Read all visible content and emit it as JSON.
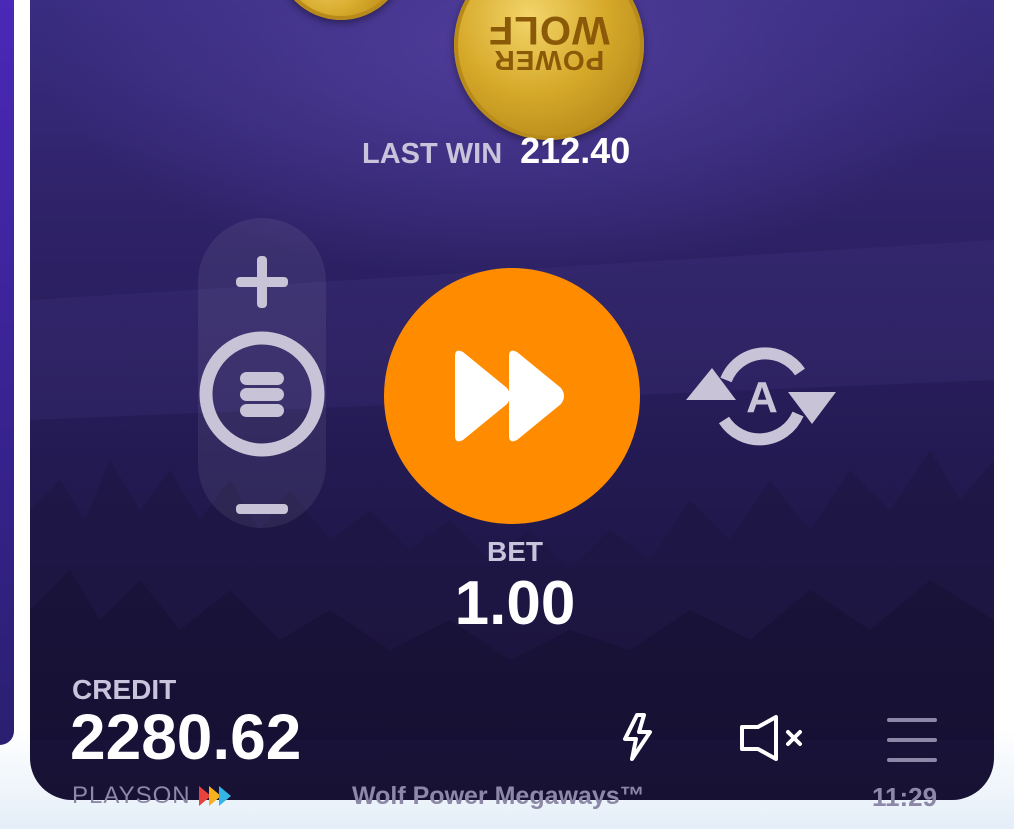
{
  "game": {
    "title": "Wolf Power Megaways™",
    "provider": "PLAYSON",
    "coin_text_1": "POWER",
    "coin_text_2": "WOLF"
  },
  "last_win": {
    "label": "LAST WIN",
    "value": "212.40"
  },
  "bet": {
    "label": "BET",
    "value": "1.00"
  },
  "credit": {
    "label": "CREDIT",
    "value": "2280.62"
  },
  "status": {
    "time": "11:29"
  },
  "controls": {
    "bet_increase": "plus-icon",
    "bet_decrease": "minus-icon",
    "bet_selector": "coin-stack-icon",
    "spin": "fast-forward-icon",
    "autoplay": "autoplay-icon",
    "turbo": "lightning-icon",
    "sound": "speaker-muted-icon",
    "menu": "hamburger-menu-icon"
  },
  "colors": {
    "spin_button": "#ff8c00",
    "text_primary": "#ffffff",
    "text_secondary": "#c9c3dc",
    "icon_gray": "#c9c3d7",
    "footer_gray": "#8d88a7"
  }
}
